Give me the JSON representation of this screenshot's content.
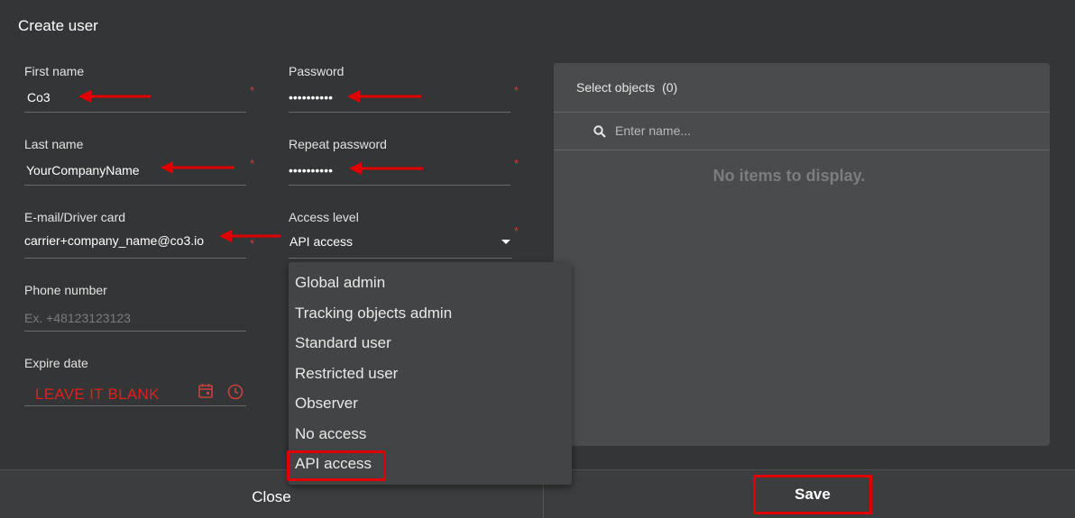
{
  "dialog": {
    "title": "Create user"
  },
  "form": {
    "first_name": {
      "label": "First name",
      "value": "Co3",
      "required": "*"
    },
    "password": {
      "label": "Password",
      "value": "••••••••••",
      "required": "*"
    },
    "last_name": {
      "label": "Last name",
      "value": "YourCompanyName",
      "required": "*"
    },
    "repeat_password": {
      "label": "Repeat password",
      "value": "••••••••••",
      "required": "*"
    },
    "email": {
      "label": "E-mail/Driver card",
      "value": "carrier+company_name@co3.io",
      "required": "*"
    },
    "access_level": {
      "label": "Access level",
      "value": "API access",
      "required": "*"
    },
    "phone": {
      "label": "Phone number",
      "placeholder": "Ex. +48123123123"
    },
    "expire_date": {
      "label": "Expire date",
      "annotation": "LEAVE IT BLANK"
    }
  },
  "access_options": [
    "Global admin",
    "Tracking objects admin",
    "Standard user",
    "Restricted user",
    "Observer",
    "No access",
    "API access"
  ],
  "objects_panel": {
    "header": "Select objects",
    "count": "(0)",
    "search_placeholder": "Enter name...",
    "empty_text": "No items to display."
  },
  "footer": {
    "close_label": "Close",
    "save_label": "Save"
  },
  "colors": {
    "annotation_red": "#e00000",
    "background": "#343536",
    "panel": "#4a4b4c"
  }
}
